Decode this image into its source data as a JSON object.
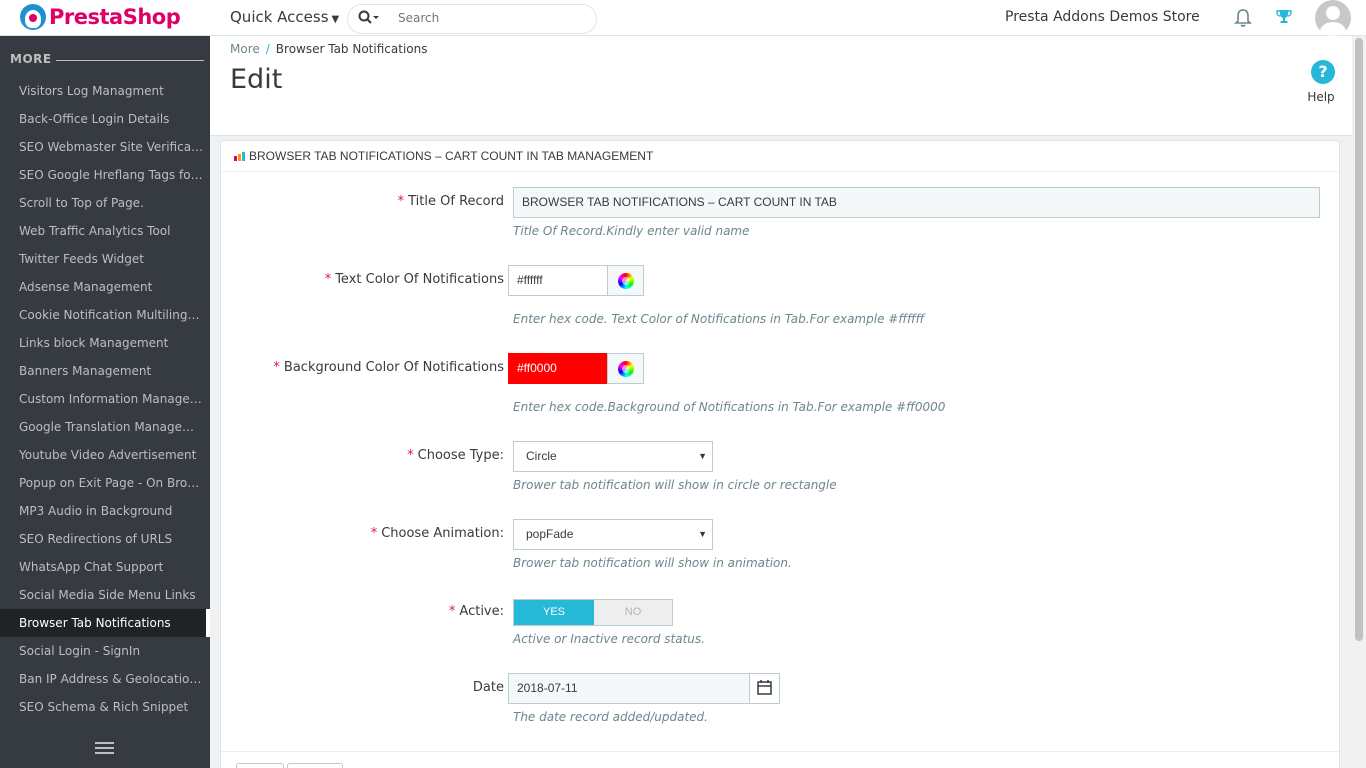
{
  "header": {
    "logo_text": "PrestaShop",
    "quick_access_label": "Quick Access",
    "search_placeholder": "Search",
    "store_name": "Presta Addons Demos Store"
  },
  "sidebar": {
    "section_label": "MORE",
    "items": [
      {
        "label": "Visitors Log Managment"
      },
      {
        "label": "Back-Office Login Details"
      },
      {
        "label": "SEO Webmaster Site Verification"
      },
      {
        "label": "SEO Google Hreflang Tags for ..."
      },
      {
        "label": "Scroll to Top of Page."
      },
      {
        "label": "Web Traffic Analytics Tool"
      },
      {
        "label": "Twitter Feeds Widget"
      },
      {
        "label": "Adsense Management"
      },
      {
        "label": "Cookie Notification Multilingual"
      },
      {
        "label": "Links block Management"
      },
      {
        "label": "Banners Management"
      },
      {
        "label": "Custom Information Managem..."
      },
      {
        "label": "Google Translation Management"
      },
      {
        "label": "Youtube Video Advertisement"
      },
      {
        "label": "Popup on Exit Page - On Brows..."
      },
      {
        "label": "MP3 Audio in Background"
      },
      {
        "label": "SEO Redirections of URLS"
      },
      {
        "label": "WhatsApp Chat Support"
      },
      {
        "label": "Social Media Side Menu Links"
      },
      {
        "label": "Browser Tab Notifications",
        "active": true
      },
      {
        "label": "Social Login - SignIn"
      },
      {
        "label": "Ban IP Address & Geolocation R..."
      },
      {
        "label": "SEO Schema & Rich Snippet"
      }
    ]
  },
  "page": {
    "breadcrumb": {
      "parent": "More",
      "separator": "/",
      "current": "Browser Tab Notifications"
    },
    "title": "Edit",
    "help_label": "Help"
  },
  "panel": {
    "title": "BROWSER TAB NOTIFICATIONS – CART COUNT IN TAB MANAGEMENT"
  },
  "form": {
    "title_record": {
      "label": "Title Of Record",
      "value": "BROWSER TAB NOTIFICATIONS – CART COUNT IN TAB",
      "help": "Title Of Record.Kindly enter valid name"
    },
    "text_color": {
      "label": "Text Color Of Notifications",
      "value": "#ffffff",
      "help": "Enter hex code. Text Color of Notifications in Tab.For example #ffffff"
    },
    "bg_color": {
      "label": "Background Color Of Notifications",
      "value": "#ff0000",
      "help": "Enter hex code.Background of Notifications in Tab.For example #ff0000"
    },
    "type": {
      "label": "Choose Type:",
      "value": "Circle",
      "help": "Brower tab notification will show in circle or rectangle"
    },
    "animation": {
      "label": "Choose Animation:",
      "value": "popFade",
      "help": "Brower tab notification will show in animation."
    },
    "active": {
      "label": "Active:",
      "yes": "YES",
      "no": "NO",
      "help": "Active or Inactive record status."
    },
    "date": {
      "label": "Date",
      "value": "2018-07-11",
      "help": "The date record added/updated."
    },
    "required_mark": "*"
  },
  "colors": {
    "accent": "#25b9d7",
    "brand": "#df0067",
    "sidebar_bg": "#363a41",
    "required": "#e50b70",
    "bg_color_swatch": "#ff0000"
  },
  "icons": [
    "search-icon",
    "bell-icon",
    "trophy-icon",
    "help-icon",
    "color-picker-icon",
    "calendar-icon",
    "menu-icon"
  ]
}
